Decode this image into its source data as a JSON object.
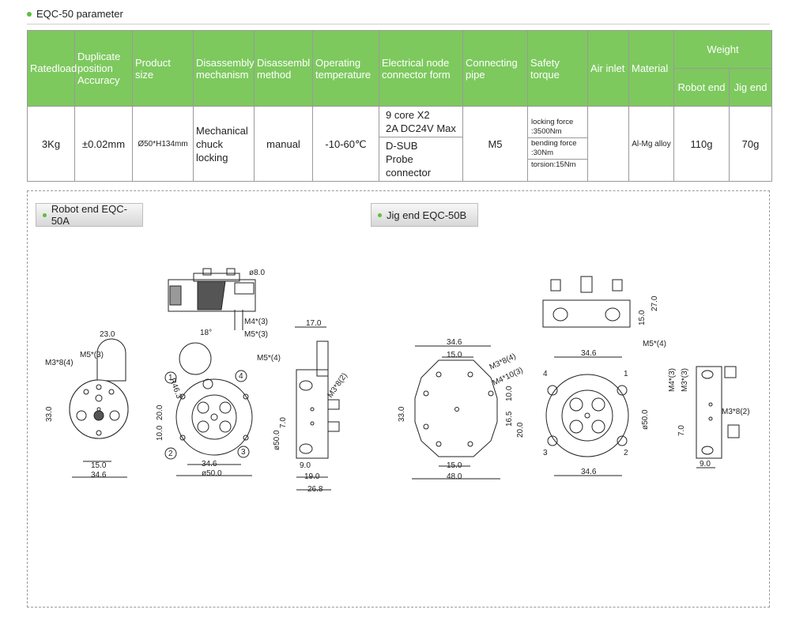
{
  "section": {
    "title": "EQC-50 parameter"
  },
  "table": {
    "headers": {
      "rated_load": "Ratedload",
      "accuracy": "Duplicate position Accuracy",
      "size": "Product size",
      "dis_mech": "Disassembly mechanism",
      "dis_method": "Disassembl method",
      "temp": "Operating temperature",
      "connector": "Electrical node connector form",
      "pipe": "Connecting pipe",
      "torque": "Safety torque",
      "air": "Air inlet",
      "material": "Material",
      "weight": "Weight",
      "robot_end": "Robot end",
      "jig_end": "Jig end"
    },
    "row": {
      "rated_load": "3Kg",
      "accuracy": "±0.02mm",
      "size": "Ø50*H134mm",
      "dis_mech": "Mechanical chuck locking",
      "dis_method": "manual",
      "temp": "-10-60℃",
      "connector_1": "9 core X2",
      "connector_2": "2A DC24V Max",
      "connector_3": "D-SUB",
      "connector_4": "Probe connector",
      "pipe": "M5",
      "torque_1": "locking force :3500Nm",
      "torque_2": "bending force :30Nm",
      "torque_3": "torsion:15Nm",
      "air": "",
      "material": "Al-Mg alloy",
      "robot_end": "110g",
      "jig_end": "70g"
    }
  },
  "drawings": {
    "tab_robot": "Robot end EQC-50A",
    "tab_jig": "Jig end EQC-50B",
    "dims": {
      "d8": "ø8.0",
      "m4x3": "M4*(3)",
      "m5x3": "M5*(3)",
      "d23": "23.0",
      "r": "18°",
      "r46": "R46.3",
      "m5x4": "M5*(4)",
      "m3x8x4": "M3*8(4)",
      "m5x3b": "M5*(3)",
      "d33": "33.0",
      "d20": "20.0",
      "d10": "10.0",
      "d15": "15.0",
      "d346": "34.6",
      "d50": "ø50.0",
      "d17": "17.0",
      "d7": "7.0",
      "m3x8x2": "M3*8(2)",
      "d50v": "ø50.0",
      "d9": "9.0",
      "d19": "19.0",
      "d268": "26.8",
      "j346": "34.6",
      "j15": "15.0",
      "jm3x8x4": "M3*8(4)",
      "jm4x10x3": "M4*10(3)",
      "j33": "33.0",
      "j10": "10.0",
      "j165": "16.5",
      "j20": "20.0",
      "j150": "15.0",
      "j48": "48.0",
      "j15h": "15.0",
      "j27": "27.0",
      "jm5x4": "M5*(4)",
      "j346b": "34.6",
      "j50": "ø50.0",
      "j346c": "34.6",
      "jm4x3": "M4*(3)",
      "jm3x3": "M3*(3)",
      "jm3x8x2": "M3*8(2)",
      "j7": "7.0",
      "j9": "9.0",
      "n1": "1",
      "n2": "2",
      "n3": "3",
      "n4": "4"
    }
  }
}
